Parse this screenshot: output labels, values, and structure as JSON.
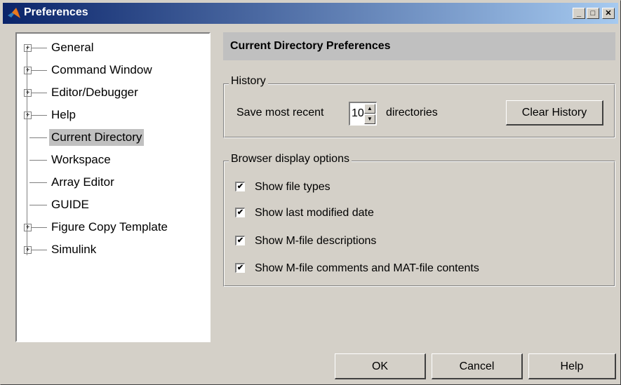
{
  "window": {
    "title": "Preferences",
    "controls": {
      "minimize": "_",
      "maximize": "□",
      "close": "✕"
    }
  },
  "tree": {
    "items": [
      {
        "label": "General",
        "expandable": true
      },
      {
        "label": "Command Window",
        "expandable": true
      },
      {
        "label": "Editor/Debugger",
        "expandable": true
      },
      {
        "label": "Help",
        "expandable": true
      },
      {
        "label": "Current Directory",
        "expandable": false,
        "selected": true
      },
      {
        "label": "Workspace",
        "expandable": false
      },
      {
        "label": "Array Editor",
        "expandable": false
      },
      {
        "label": "GUIDE",
        "expandable": false
      },
      {
        "label": "Figure Copy Template",
        "expandable": true
      },
      {
        "label": "Simulink",
        "expandable": true
      }
    ]
  },
  "panel": {
    "title": "Current Directory Preferences",
    "history": {
      "group_label": "History",
      "save_prefix": "Save most recent",
      "recent_value": "10",
      "save_suffix": "directories",
      "clear_button": "Clear History"
    },
    "browser": {
      "group_label": "Browser display options",
      "options": [
        {
          "label": "Show file types",
          "checked": true
        },
        {
          "label": "Show last modified date",
          "checked": true
        },
        {
          "label": "Show M-file descriptions",
          "checked": true
        },
        {
          "label": "Show M-file comments and MAT-file contents",
          "checked": true
        }
      ]
    }
  },
  "footer": {
    "ok": "OK",
    "cancel": "Cancel",
    "help": "Help"
  },
  "colors": {
    "face": "#d4d0c8",
    "title_start": "#0a246a",
    "title_end": "#a6caf0",
    "selection": "#c0c0c0",
    "header_bar": "#c0c0c0"
  },
  "icons": {
    "app": "matlab-logo-icon",
    "check": "checkmark-icon",
    "expand": "plus-box-icon"
  }
}
